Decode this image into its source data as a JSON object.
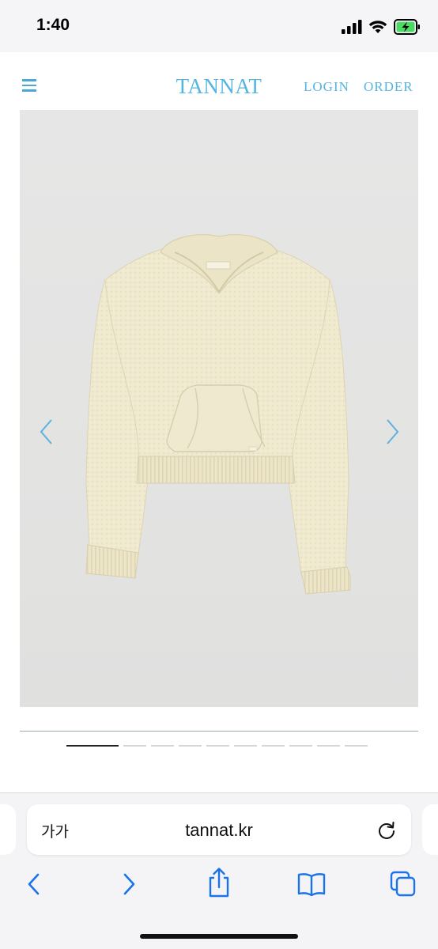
{
  "status_bar": {
    "time": "1:40",
    "icons": [
      "cellular-signal-icon",
      "wifi-icon",
      "battery-charging-icon"
    ],
    "battery_color": "#4cd964"
  },
  "header": {
    "menu_icon": "hamburger-menu-icon",
    "logo": "TANNAT",
    "login": "LOGIN",
    "order": "ORDER",
    "accent_color": "#55b4e0"
  },
  "product": {
    "image_subject": "cream knit hooded cropped sweater",
    "prev_icon": "chevron-left-icon",
    "next_icon": "chevron-right-icon",
    "slide_count": 11,
    "active_slide": 1
  },
  "browser": {
    "aa_label": "가가",
    "url": "tannat.kr",
    "reload_icon": "reload-icon",
    "toolbar": [
      "back-icon",
      "forward-icon",
      "share-icon",
      "bookmarks-icon",
      "tabs-icon"
    ],
    "toolbar_color": "#1a73e8"
  }
}
